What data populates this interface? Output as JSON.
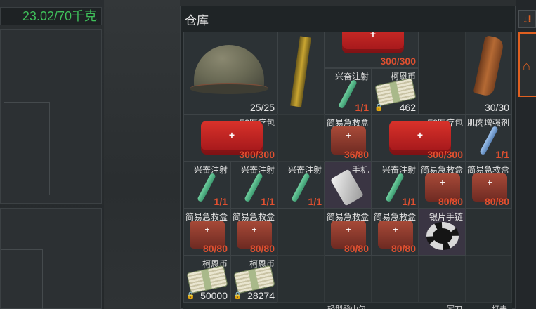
{
  "weight": "23.02/70千克",
  "warehouse_title": "仓库",
  "items": {
    "helmet": {
      "count": "25/25"
    },
    "medkit_top": {
      "count": "300/300"
    },
    "syringe1": {
      "name": "兴奋注射",
      "count": "1/1"
    },
    "coin1": {
      "name": "柯恩币",
      "count": "462"
    },
    "mag": {
      "count": "30/30"
    },
    "medkit_e3_1": {
      "name": "E3医疗包",
      "count": "300/300"
    },
    "box1": {
      "name": "简易急救盒",
      "count": "36/80"
    },
    "medkit_e3_2": {
      "name": "E3医疗包",
      "count": "300/300"
    },
    "muscle": {
      "name": "肌肉增强剂",
      "count": "1/1"
    },
    "syr_r3_1": {
      "name": "兴奋注射",
      "count": "1/1"
    },
    "syr_r3_2": {
      "name": "兴奋注射",
      "count": "1/1"
    },
    "syr_r3_3": {
      "name": "兴奋注射",
      "count": "1/1"
    },
    "phone": {
      "name": "手机"
    },
    "syr_r3_5": {
      "name": "兴奋注射",
      "count": "1/1"
    },
    "box_r3_6": {
      "name": "简易急救盒",
      "count": "80/80"
    },
    "box_r3_7": {
      "name": "简易急救盒",
      "count": "80/80"
    },
    "box_r4_1": {
      "name": "简易急救盒",
      "count": "80/80"
    },
    "box_r4_2": {
      "name": "简易急救盒",
      "count": "80/80"
    },
    "box_r4_4": {
      "name": "简易急救盒",
      "count": "80/80"
    },
    "box_r4_5": {
      "name": "简易急救盒",
      "count": "80/80"
    },
    "bracelet": {
      "name": "银片手链"
    },
    "coin2": {
      "name": "柯恩币",
      "count": "50000"
    },
    "coin3": {
      "name": "柯恩币",
      "count": "28274"
    }
  },
  "bottom_partial": [
    "轻型登山包",
    "军刀",
    "打击"
  ],
  "kit_label": "简易急救盒",
  "cross": "+",
  "lock": "🔒",
  "sort_icon": "↓⁝",
  "home_icon": "⌂"
}
